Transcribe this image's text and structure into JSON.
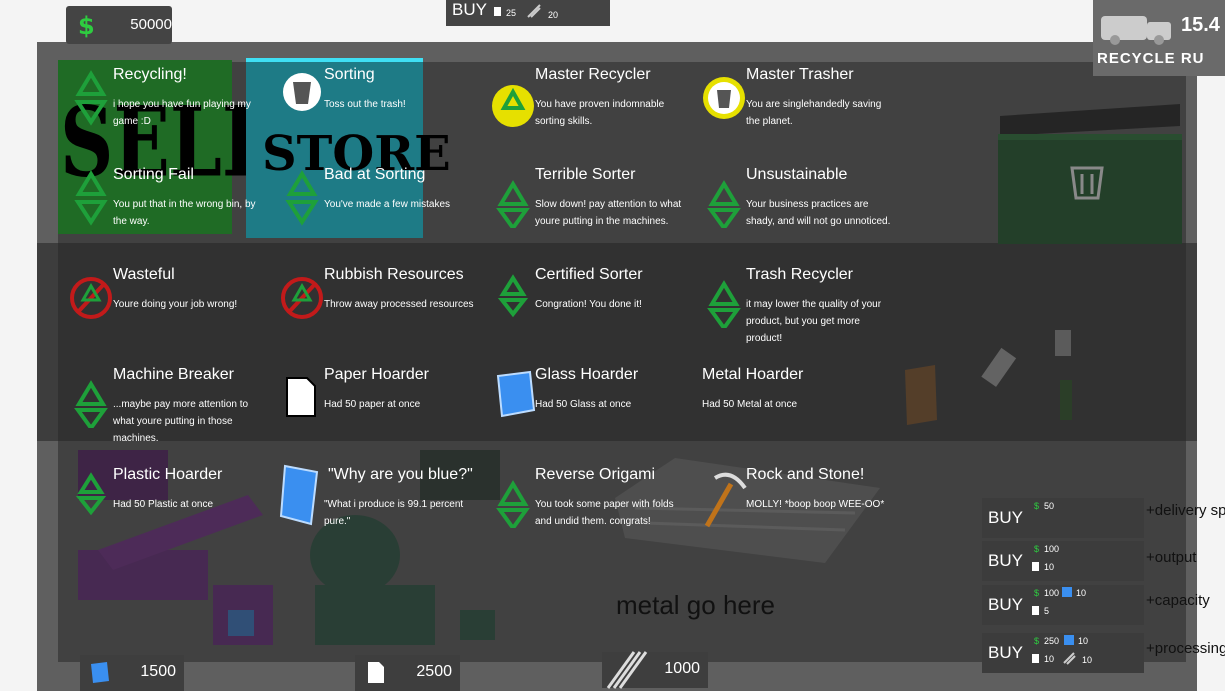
{
  "hud": {
    "money": "50000",
    "top_buy": {
      "label": "BUY",
      "paper_cost": "25",
      "metal_cost": "20"
    },
    "truck_timer": "15.4",
    "recycle_run_label": "RECYCLE RU"
  },
  "overlay_buttons": {
    "sell": "SELL",
    "store": "STORE"
  },
  "achievements": [
    {
      "title": "Recycling!",
      "desc": "i hope you have fun playing my game :D"
    },
    {
      "title": "Sorting",
      "desc": "Toss out the trash!"
    },
    {
      "title": "Master Recycler",
      "desc": "You have proven indomnable sorting skills."
    },
    {
      "title": "Master Trasher",
      "desc": "You are singlehandedly saving the planet."
    },
    {
      "title": "Sorting Fail",
      "desc": "You put that in the wrong bin, by the way."
    },
    {
      "title": "Bad at Sorting",
      "desc": "You've made a few mistakes"
    },
    {
      "title": "Terrible Sorter",
      "desc": "Slow down! pay attention to what youre putting in the machines."
    },
    {
      "title": "Unsustainable",
      "desc": "Your business practices are shady, and will not go unnoticed."
    },
    {
      "title": "Wasteful",
      "desc": "Youre doing your job wrong!"
    },
    {
      "title": "Rubbish Resources",
      "desc": "Throw away processed resources"
    },
    {
      "title": "Certified Sorter",
      "desc": "Congration! You done it!"
    },
    {
      "title": "Trash Recycler",
      "desc": "it may lower the quality of your product, but you get more product!"
    },
    {
      "title": "Machine Breaker",
      "desc": "...maybe pay more attention to what youre putting in those machines."
    },
    {
      "title": "Paper Hoarder",
      "desc": "Had 50 paper at once"
    },
    {
      "title": "Glass Hoarder",
      "desc": "Had 50 Glass at once"
    },
    {
      "title": "Metal Hoarder",
      "desc": "Had 50 Metal at once"
    },
    {
      "title": "Plastic Hoarder",
      "desc": "Had 50 Plastic at once"
    },
    {
      "title": "\"Why are you blue?\"",
      "desc": "\"What i produce is 99.1 percent pure.\""
    },
    {
      "title": "Reverse Origami",
      "desc": "You took some paper with folds and undid them. congrats!"
    },
    {
      "title": "Rock and Stone!",
      "desc": "MOLLY! *boop boop WEE-OO*"
    }
  ],
  "metal_hint": "metal go here",
  "resources": {
    "glass": "1500",
    "paper": "2500",
    "metal": "1000"
  },
  "upgrades": [
    {
      "button": "BUY",
      "money": "50",
      "label": "+delivery sp"
    },
    {
      "button": "BUY",
      "money": "100",
      "paper": "10",
      "label": "+output"
    },
    {
      "button": "BUY",
      "money": "100",
      "glass": "10",
      "paper": "5",
      "label": "+capacity"
    },
    {
      "button": "BUY",
      "money": "250",
      "glass": "10",
      "paper": "10",
      "metal": "10",
      "label": "+processing"
    }
  ]
}
